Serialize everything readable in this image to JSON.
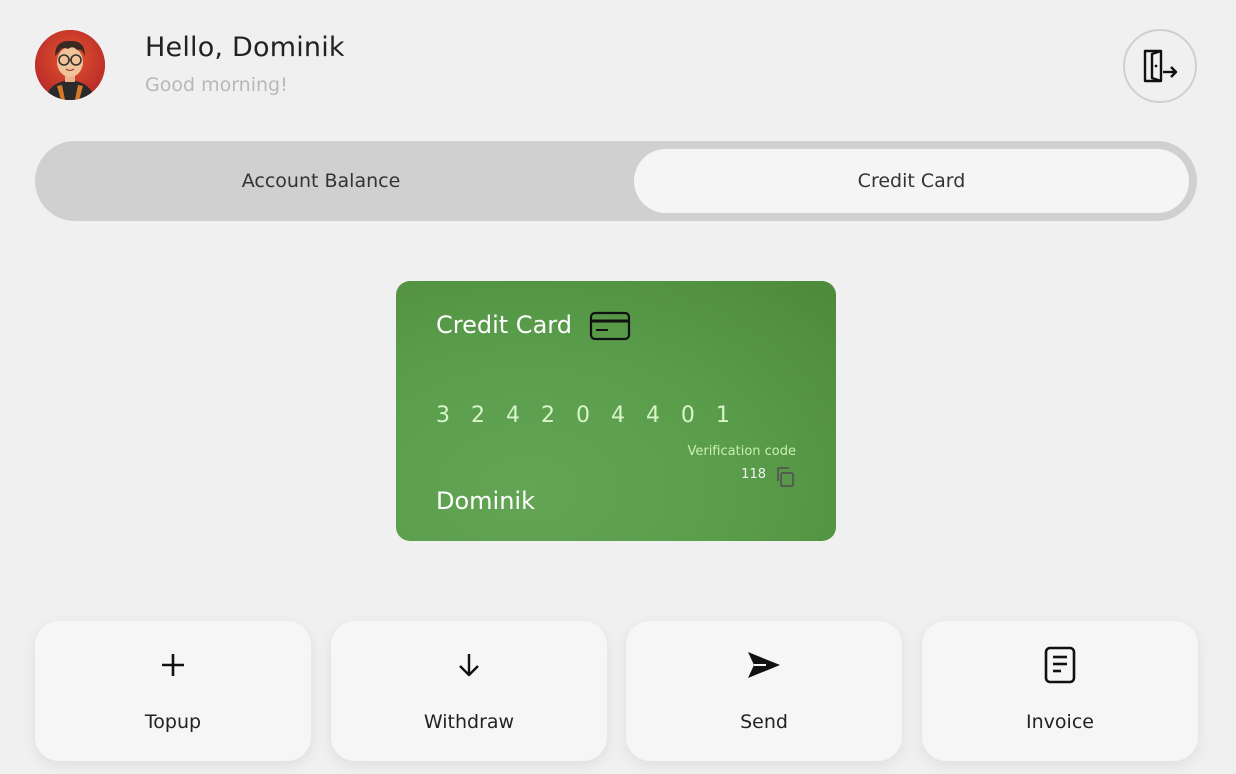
{
  "header": {
    "greeting": "Hello, Dominik",
    "subgreeting": "Good morning!",
    "logout_icon": "logout-door-icon"
  },
  "tabs": [
    {
      "label": "Account Balance",
      "active": false
    },
    {
      "label": "Credit Card",
      "active": true
    }
  ],
  "card": {
    "title": "Credit Card",
    "icon": "credit-card-icon",
    "number": "3 2 4 2 0 4 4 0 1",
    "verification_label": "Verification code",
    "verification_code": "118",
    "holder": "Dominik",
    "colors": {
      "start": "#63a455",
      "end": "#4d8a3a"
    }
  },
  "actions": [
    {
      "label": "Topup",
      "icon": "plus-icon"
    },
    {
      "label": "Withdraw",
      "icon": "arrow-down-icon"
    },
    {
      "label": "Send",
      "icon": "send-icon"
    },
    {
      "label": "Invoice",
      "icon": "invoice-icon"
    }
  ]
}
